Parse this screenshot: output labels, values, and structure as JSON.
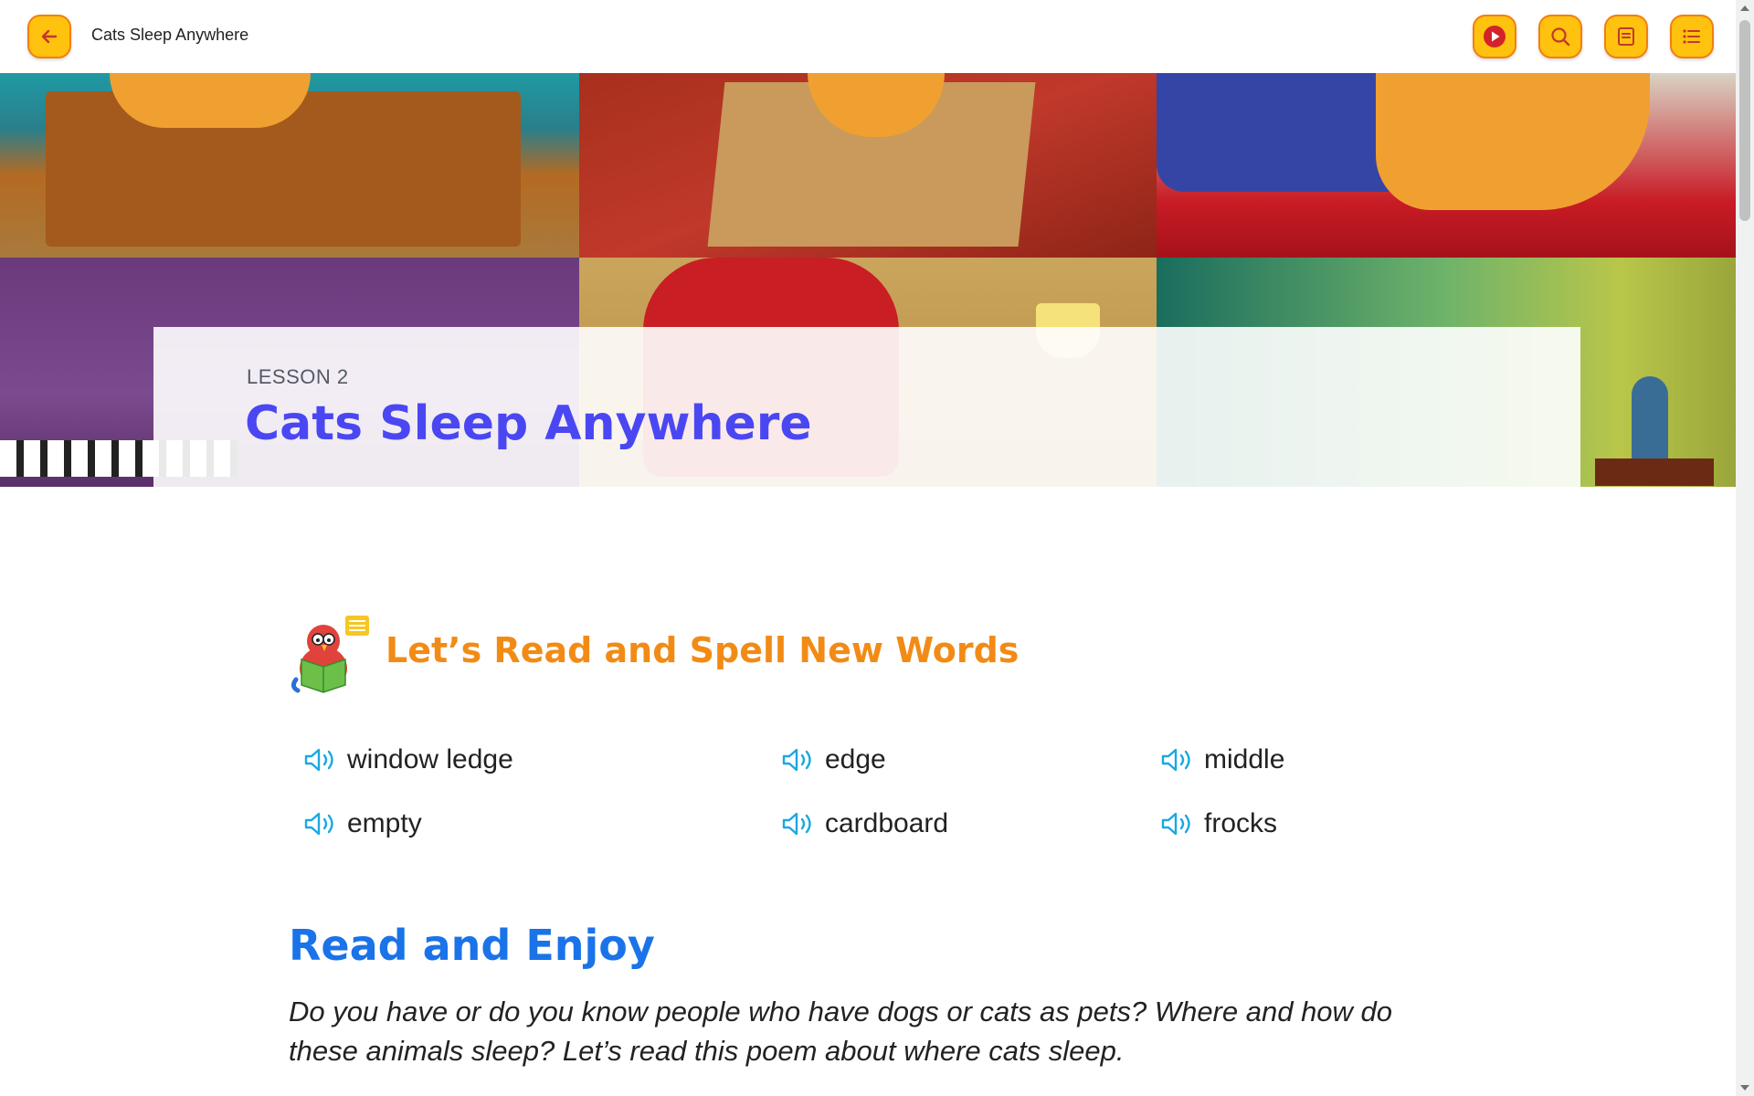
{
  "header": {
    "title": "Cats Sleep Anywhere",
    "back_icon": "arrow-left-icon",
    "actions": [
      {
        "name": "play-button",
        "icon": "play-icon"
      },
      {
        "name": "search-button",
        "icon": "search-icon"
      },
      {
        "name": "notes-button",
        "icon": "note-icon"
      },
      {
        "name": "menu-button",
        "icon": "list-icon"
      }
    ]
  },
  "hero": {
    "lesson_label": "LESSON 2",
    "lesson_title": "Cats Sleep Anywhere"
  },
  "words_section": {
    "title": "Let’s Read and Spell New Words",
    "words": [
      "window ledge",
      "edge",
      "middle",
      "empty",
      "cardboard",
      "frocks"
    ]
  },
  "read_section": {
    "title": "Read and Enjoy",
    "intro": "Do you have or do you know people who have dogs or cats as pets? Where and how do these animals sleep? Let’s read this poem about where cats sleep."
  },
  "colors": {
    "button_fill": "#ffc20e",
    "button_border": "#f47e10",
    "lesson_title": "#4a47f2",
    "section_title": "#f28b16",
    "read_title": "#1a73e8",
    "speaker_icon": "#1aa9e0"
  }
}
